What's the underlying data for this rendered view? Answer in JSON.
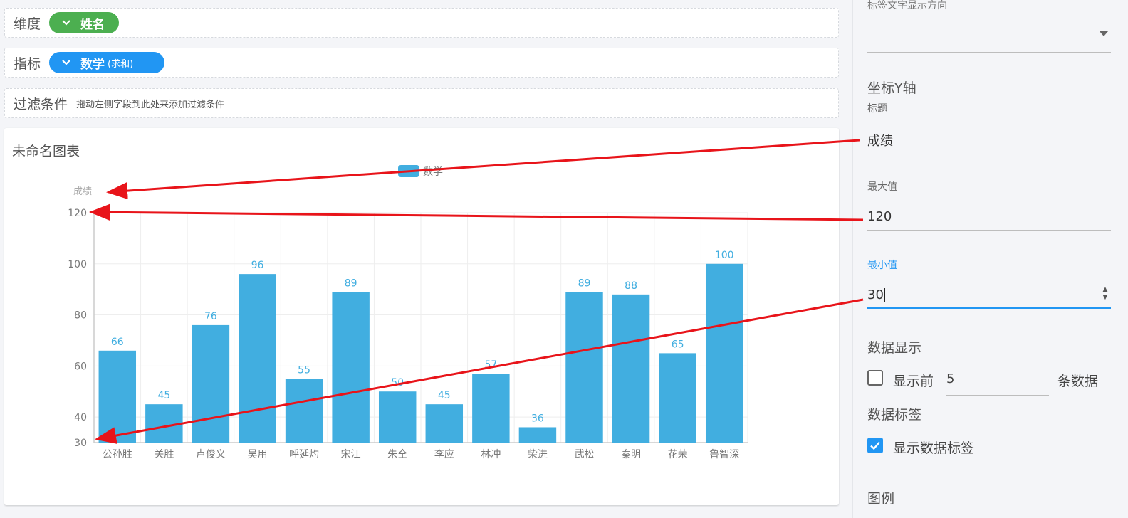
{
  "dimension_row": {
    "label": "维度",
    "pill_label": "姓名",
    "pill_icon": "chevron-down-icon",
    "pill_color": "#4caf50"
  },
  "metric_row": {
    "label": "指标",
    "pill_label": "数学",
    "pill_sub": "(求和)",
    "pill_icon": "chevron-down-icon",
    "pill_color": "#2196f3"
  },
  "filter_row": {
    "label": "过滤条件",
    "hint": "拖动左侧字段到此处来添加过滤条件"
  },
  "chart_card": {
    "title": "未命名图表"
  },
  "chart_data": {
    "type": "bar",
    "categories": [
      "公孙胜",
      "关胜",
      "卢俊义",
      "吴用",
      "呼延灼",
      "宋江",
      "朱仝",
      "李应",
      "林冲",
      "柴进",
      "武松",
      "秦明",
      "花荣",
      "鲁智深"
    ],
    "series": [
      {
        "name": "数学",
        "values": [
          66,
          45,
          76,
          96,
          55,
          89,
          50,
          45,
          57,
          36,
          89,
          88,
          65,
          100
        ],
        "color": "#41aee0"
      }
    ],
    "ylabel": "成绩",
    "ylim": [
      30,
      120
    ],
    "yticks": [
      "30",
      "40",
      "60",
      "80",
      "100",
      "120"
    ],
    "show_data_labels": true,
    "legend_position": "top-center",
    "grid": true
  },
  "panel": {
    "label_direction_label": "标签文字显示方向",
    "label_direction_value": "",
    "y_axis_section": "坐标Y轴",
    "title_label": "标题",
    "title_value": "成绩",
    "max_label": "最大值",
    "max_value": "120",
    "min_label": "最小值",
    "min_value": "30",
    "data_display_section": "数据显示",
    "show_top_label": "显示前",
    "show_top_value": "5",
    "show_top_suffix": "条数据",
    "show_top_checked": false,
    "data_labels_section": "数据标签",
    "show_data_labels_label": "显示数据标签",
    "show_data_labels_checked": true,
    "legend_section": "图例"
  },
  "colors": {
    "accent": "#2196f3",
    "annotation_arrow": "#e8141a"
  }
}
